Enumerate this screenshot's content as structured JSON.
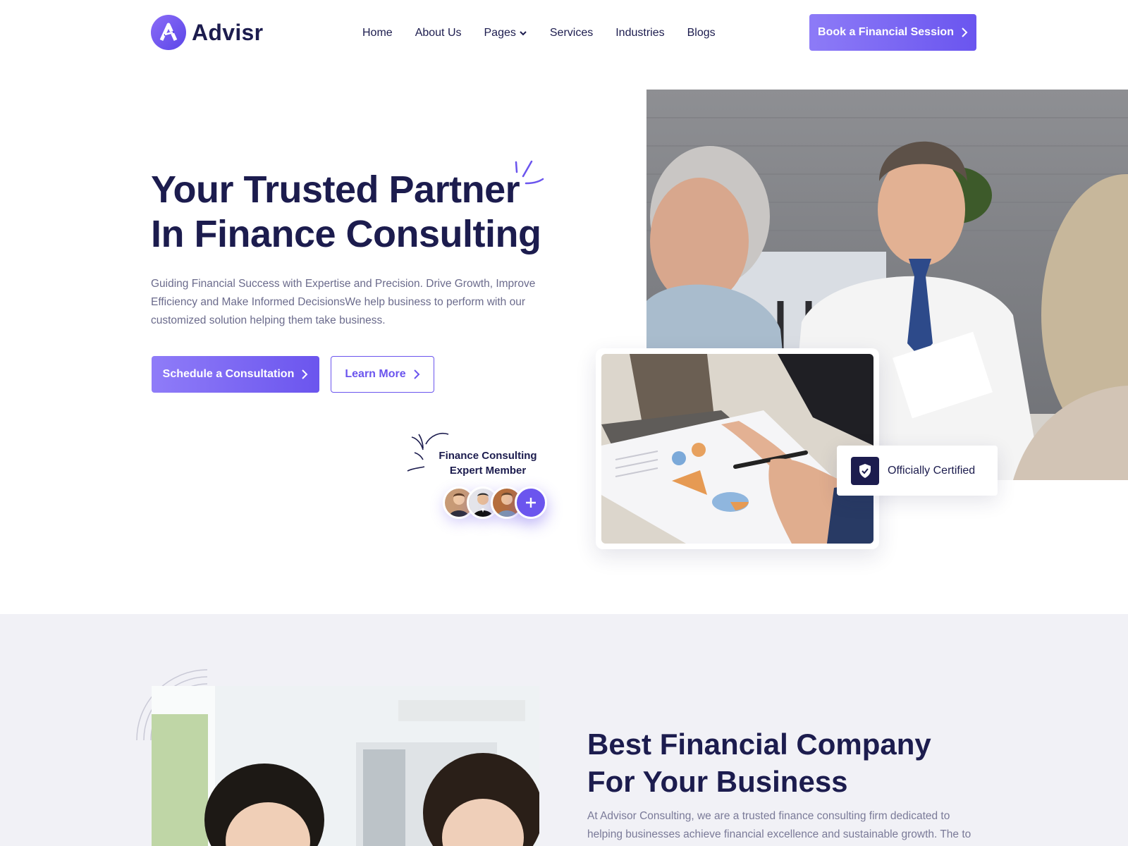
{
  "brand": {
    "name": "Advisr",
    "accent": "#6b55ee",
    "dark": "#1c1c4e"
  },
  "nav": {
    "items": [
      {
        "label": "Home"
      },
      {
        "label": "About Us"
      },
      {
        "label": "Pages"
      },
      {
        "label": "Services"
      },
      {
        "label": "Industries"
      },
      {
        "label": "Blogs"
      }
    ],
    "cta_label": "Book a Financial Session"
  },
  "hero": {
    "title_line1": "Your Trusted Partner",
    "title_line2": "In Finance Consulting",
    "description": "Guiding Financial Success with Expertise and Precision. Drive Growth, Improve Efficiency and Make Informed DecisionsWe help business to perform with our customized solution helping them take business.",
    "primary_button": "Schedule a Consultation",
    "secondary_button": "Learn More",
    "expert_label_line1": "Finance Consulting",
    "expert_label_line2": "Expert Member",
    "certified_label": "Officially Certified"
  },
  "about": {
    "title_line1": "Best Financial Company",
    "title_line2": "For Your Business",
    "description": "At Advisor Consulting, we are a trusted finance consulting firm dedicated to helping businesses achieve financial excellence and sustainable growth. The to"
  },
  "icons": {
    "logo": "logo-a-icon",
    "chevron_down": "chevron-down-icon",
    "chevron_right": "chevron-right-icon",
    "plus": "plus-icon",
    "shield": "shield-check-icon"
  }
}
